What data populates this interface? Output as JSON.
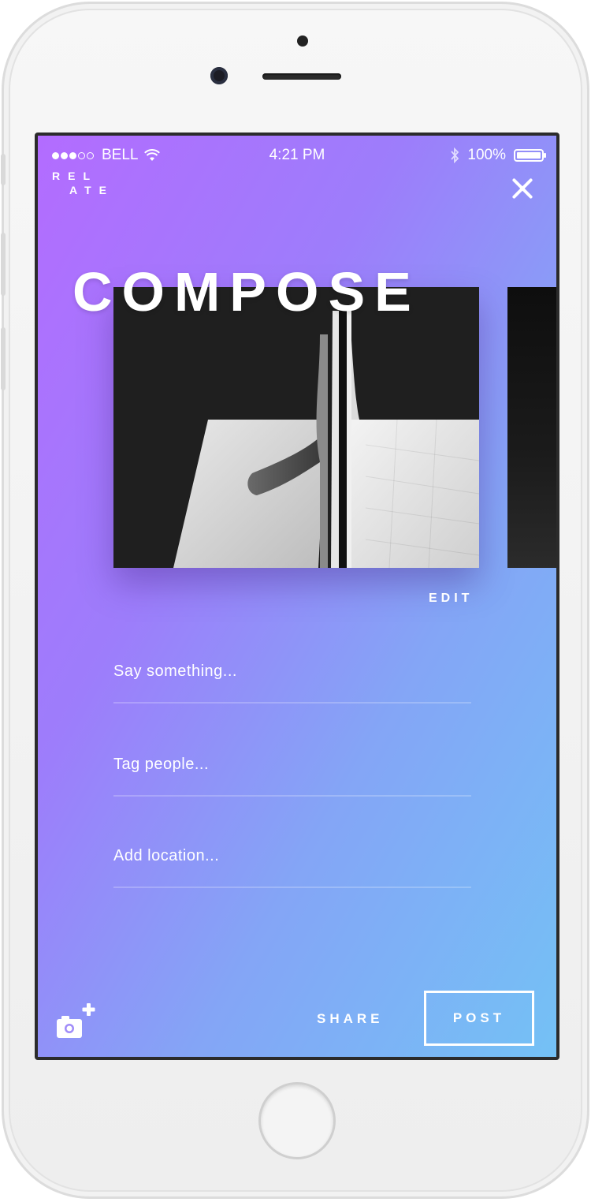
{
  "status_bar": {
    "carrier": "BELL",
    "time": "4:21 PM",
    "battery": "100%",
    "signal_icon": "signal-dots-icon",
    "wifi_icon": "wifi-icon",
    "bluetooth_icon": "bluetooth-icon",
    "battery_icon": "battery-icon"
  },
  "app": {
    "logo_line1": "REL",
    "logo_line2": "ATE"
  },
  "header": {
    "title": "COMPOSE",
    "close_icon": "close-icon"
  },
  "media": {
    "edit_label": "EDIT"
  },
  "form": {
    "caption_placeholder": "Say something...",
    "tag_placeholder": "Tag people...",
    "location_placeholder": "Add location..."
  },
  "footer": {
    "add_photo_icon": "camera-plus-icon",
    "share_label": "SHARE",
    "post_label": "POST"
  },
  "colors": {
    "gradient_start": "#b36cff",
    "gradient_end": "#74c1f5",
    "text": "#ffffff"
  }
}
